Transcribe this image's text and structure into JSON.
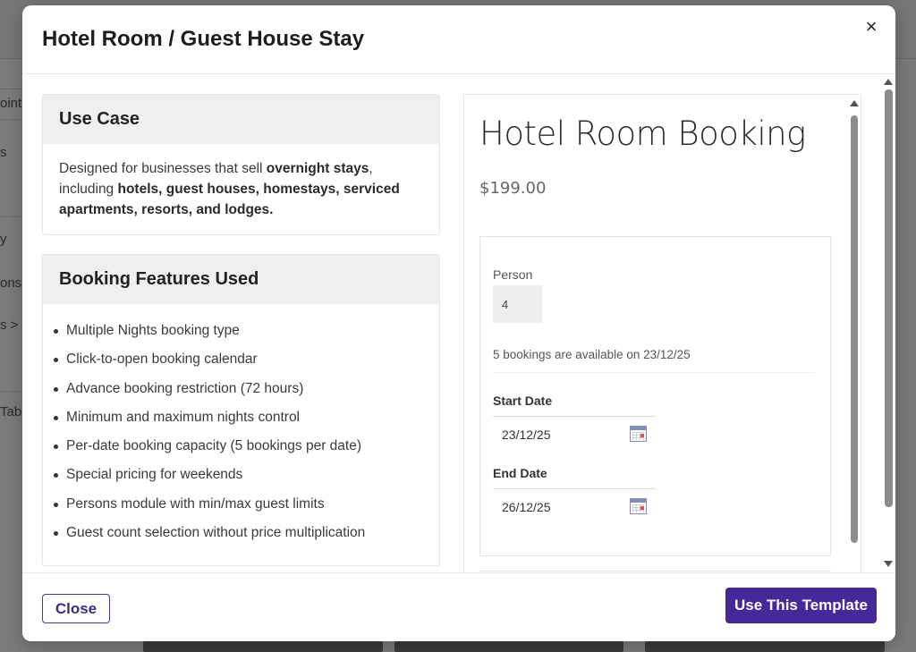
{
  "background": {
    "sidebar_items": [
      "oint",
      "s",
      "y",
      "ons",
      "s >",
      "Tab"
    ]
  },
  "modal": {
    "title": "Hotel Room / Guest House Stay",
    "close_icon": "close-icon"
  },
  "use_case": {
    "heading": "Use Case",
    "text_1": "Designed for businesses that sell ",
    "bold_1": "overnight stays",
    "text_2": ", including ",
    "bold_2": "hotels, guest houses, homestays, serviced apartments, resorts, and lodges."
  },
  "booking_features": {
    "heading": "Booking Features Used",
    "items": [
      "Multiple Nights booking type",
      "Click-to-open booking calendar",
      "Advance booking restriction (72 hours)",
      "Minimum and maximum nights control",
      "Per-date booking capacity (5 bookings per date)",
      "Special pricing for weekends",
      "Persons module with min/max guest limits",
      "Guest count selection without price multiplication"
    ]
  },
  "preview": {
    "title": "Hotel Room Booking",
    "price": "$199.00",
    "person_label": "Person",
    "person_value": "4",
    "availability": "5 bookings are available on 23/12/25",
    "start_date_label": "Start Date",
    "start_date_value": "23/12/25",
    "end_date_label": "End Date",
    "end_date_value": "26/12/25",
    "calendar_icon": "calendar-icon"
  },
  "footer": {
    "close_label": "Close",
    "use_template_label": "Use This Template"
  },
  "colors": {
    "accent": "#46289a",
    "card_header_bg": "#efefef",
    "backdrop": "#7a7a7a"
  }
}
